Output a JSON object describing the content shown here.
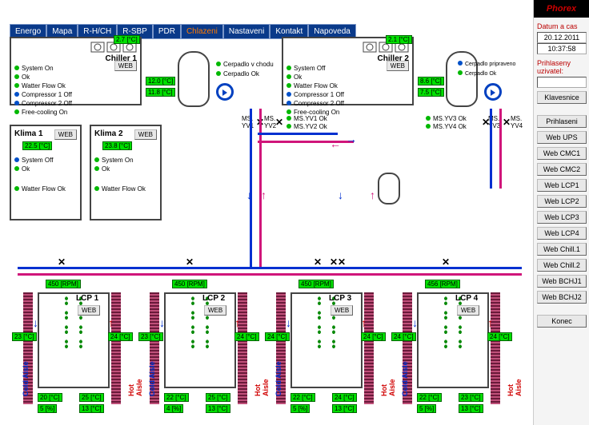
{
  "nav": {
    "items": [
      "Energo",
      "Mapa",
      "R-H/CH",
      "R-SBP",
      "PDR",
      "Chlazeni",
      "Nastaveni",
      "Kontakt",
      "Napoveda"
    ],
    "active": 5
  },
  "sidebar": {
    "brand": "Phorex",
    "date_label": "Datum a cas",
    "date": "20.12.2011",
    "time": "10:37:58",
    "user_label": "Prihlaseny uzivatel:",
    "user": "",
    "buttons": [
      "Klavesnice",
      "Prihlaseni",
      "Web UPS",
      "Web CMC1",
      "Web CMC2",
      "Web LCP1",
      "Web LCP2",
      "Web LCP3",
      "Web LCP4",
      "Web Chill.1",
      "Web Chill.2",
      "Web BCHJ1",
      "Web BCHJ2",
      "Konec"
    ]
  },
  "chiller1": {
    "title": "Chiller 1",
    "top_temp": "2.7 [°C]",
    "out_temp1": "12.0 [°C]",
    "out_temp2": "11.8 [°C]",
    "web": "WEB",
    "status": [
      {
        "c": "g",
        "t": "System On"
      },
      {
        "c": "g",
        "t": "Ok"
      },
      {
        "c": "g",
        "t": "Watter Flow Ok"
      },
      {
        "c": "b",
        "t": "Compressor 1 Off"
      },
      {
        "c": "b",
        "t": "Compressor 2 Off"
      },
      {
        "c": "g",
        "t": "Free-cooling On"
      }
    ]
  },
  "chiller2": {
    "title": "Chiller 2",
    "top_temp": "2.1 [°C]",
    "out_temp1": "8.6 [°C]",
    "out_temp2": "7.5 [°C]",
    "web": "WEB",
    "status": [
      {
        "c": "g",
        "t": "System Off"
      },
      {
        "c": "g",
        "t": "Ok"
      },
      {
        "c": "g",
        "t": "Watter Flow Ok"
      },
      {
        "c": "b",
        "t": "Compressor 1 Off"
      },
      {
        "c": "b",
        "t": "Compressor 2 Off"
      },
      {
        "c": "g",
        "t": "Free-cooling On"
      }
    ]
  },
  "cerpadlo1": {
    "s1": {
      "c": "g",
      "t": "Cerpadlo v chodu"
    },
    "s2": {
      "c": "g",
      "t": "Cerpadlo Ok"
    }
  },
  "cerpadlo2": {
    "s1": {
      "c": "b",
      "t": "Cerpadlo pripraveno"
    },
    "s2": {
      "c": "g",
      "t": "Cerpadlo Ok"
    }
  },
  "valves": {
    "yv1": "MS.\nYV1",
    "yv2": "MS.\nYV2",
    "yv3": "MS.\nYV3",
    "yv4": "MS.\nYV4",
    "yv1ok": "MS.YV1 Ok",
    "yv2ok": "MS.YV2 Ok",
    "yv3ok": "MS.YV3 Ok",
    "yv4ok": "MS.YV4 Ok"
  },
  "klima1": {
    "title": "Klima 1",
    "web": "WEB",
    "temp": "22.5 [°C]",
    "status": [
      {
        "c": "b",
        "t": "System Off"
      },
      {
        "c": "g",
        "t": "Ok"
      },
      {
        "c": "g",
        "t": "Watter Flow Ok"
      }
    ]
  },
  "klima2": {
    "title": "Klima 2",
    "web": "WEB",
    "temp": "23.8 [°C]",
    "status": [
      {
        "c": "g",
        "t": "System On"
      },
      {
        "c": "g",
        "t": "Ok"
      },
      {
        "c": "g",
        "t": "Watter Flow Ok"
      }
    ]
  },
  "lcps": [
    {
      "title": "LCP 1",
      "rpm": "450 [RPM]",
      "cold_in": "23 [°C]",
      "hot_in": "24 [°C]",
      "out1": "20 [°C]",
      "out2": "5 [%]",
      "out3": "25 [°C]",
      "out4": "13 [°C]"
    },
    {
      "title": "LCP 2",
      "rpm": "450 [RPM]",
      "cold_in": "23 [°C]",
      "hot_in": "24 [°C]",
      "out1": "22 [°C]",
      "out2": "4 [%]",
      "out3": "25 [°C]",
      "out4": "13 [°C]"
    },
    {
      "title": "LCP 3",
      "rpm": "450 [RPM]",
      "cold_in": "24 [°C]",
      "hot_in": "24 [°C]",
      "out1": "22 [°C]",
      "out2": "5 [%]",
      "out3": "24 [°C]",
      "out4": "13 [°C]"
    },
    {
      "title": "LCP 4",
      "rpm": "456 [RPM]",
      "cold_in": "24 [°C]",
      "hot_in": "24 [°C]",
      "out1": "22 [°C]",
      "out2": "5 [%]",
      "out3": "23 [°C]",
      "out4": "13 [°C]"
    }
  ],
  "labels": {
    "cold": "Cold Aisle",
    "hot": "Hot Aisle",
    "web": "WEB"
  }
}
